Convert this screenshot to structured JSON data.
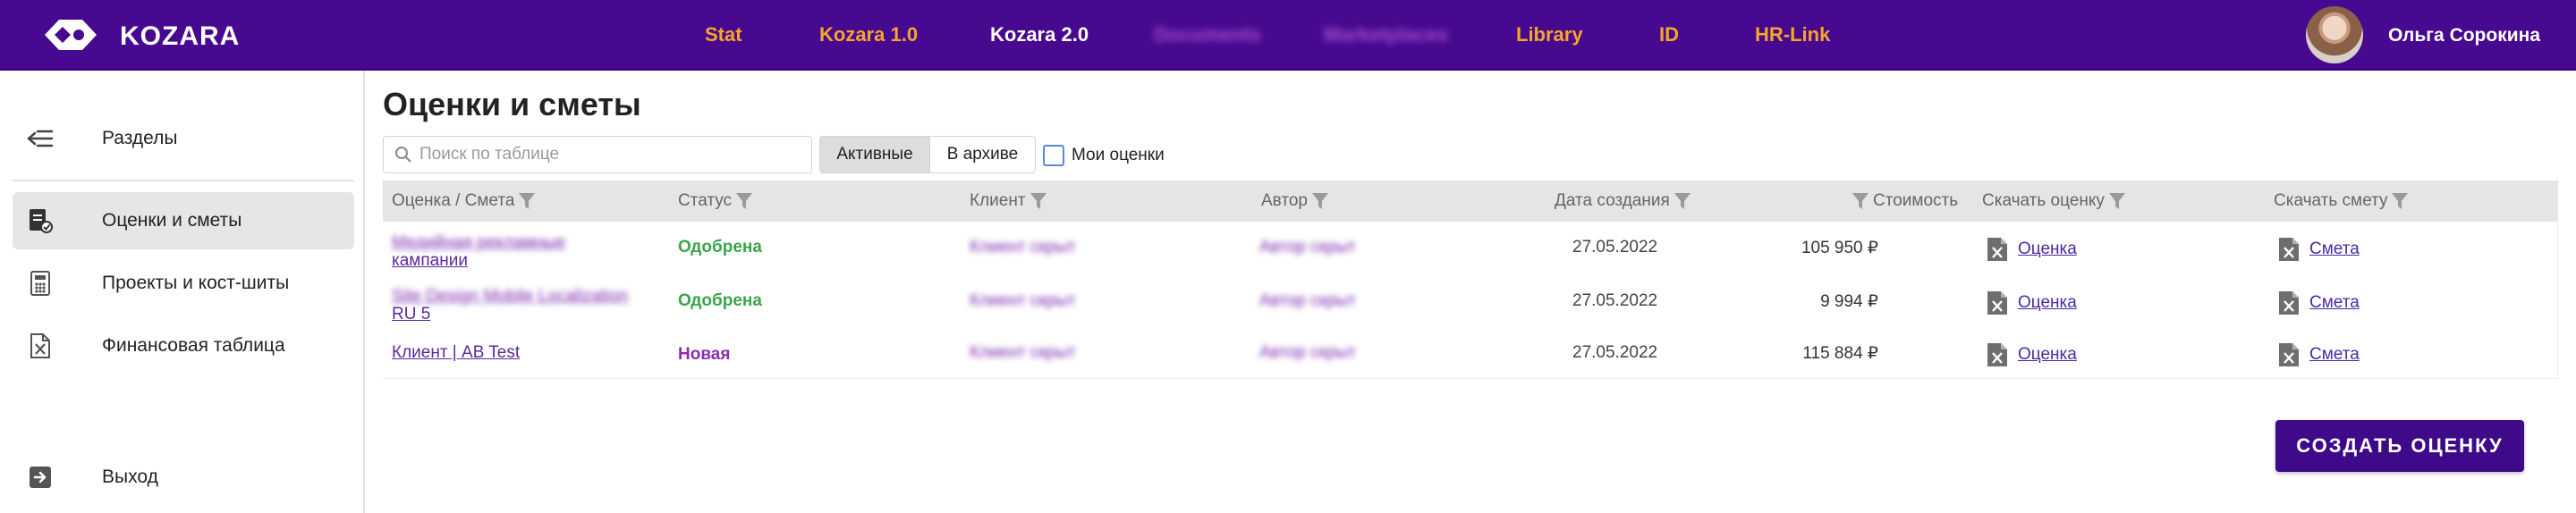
{
  "header": {
    "logo_text": "KOZARA",
    "nav": [
      {
        "label": "Stat"
      },
      {
        "label": "Kozara 1.0"
      },
      {
        "label": "Kozara 2.0"
      },
      {
        "label": "Documents"
      },
      {
        "label": "Marketplaces"
      },
      {
        "label": "Library"
      },
      {
        "label": "ID"
      },
      {
        "label": "HR-Link"
      }
    ],
    "user_name": "Ольга Сорокина"
  },
  "sidebar": {
    "items": [
      {
        "label": "Разделы",
        "icon": "collapse-menu-icon"
      },
      {
        "label": "Оценки и сметы",
        "icon": "estimates-icon"
      },
      {
        "label": "Проекты и кост-шиты",
        "icon": "calculator-icon"
      },
      {
        "label": "Финансовая таблица",
        "icon": "excel-file-icon"
      },
      {
        "label": "Выход",
        "icon": "exit-icon"
      }
    ]
  },
  "main": {
    "title": "Оценки и сметы",
    "search_placeholder": "Поиск по таблице",
    "tabs": {
      "active": "Активные",
      "archive": "В архиве"
    },
    "my_estimates_label": "Мои оценки",
    "create_button": "СОЗДАТЬ ОЦЕНКУ"
  },
  "table": {
    "columns": [
      "Оценка / Смета",
      "Статус",
      "Клиент",
      "Автор",
      "Дата создания",
      "Стоимость",
      "Скачать оценку",
      "Скачать смету"
    ],
    "rows": [
      {
        "name_line1": "Медийная рекламные",
        "name_line2": "кампании",
        "status": "Одобрена",
        "client": "Клиент скрыт",
        "author": "Автор скрыт",
        "date": "27.05.2022",
        "cost": "105 950 ₽",
        "estimate_link": "Оценка",
        "smeta_link": "Смета"
      },
      {
        "name_line1": "Site Design Mobile Localization",
        "name_line2": "RU 5",
        "status": "Одобрена",
        "client": "Клиент скрыт",
        "author": "Автор скрыт",
        "date": "27.05.2022",
        "cost": "9 994 ₽",
        "estimate_link": "Оценка",
        "smeta_link": "Смета"
      },
      {
        "name_line1": "Клиент | AB Test",
        "name_line2": "",
        "status": "Новая",
        "client": "Клиент скрыт",
        "author": "Автор скрыт",
        "date": "27.05.2022",
        "cost": "115 884 ₽",
        "estimate_link": "Оценка",
        "smeta_link": "Смета"
      }
    ]
  }
}
